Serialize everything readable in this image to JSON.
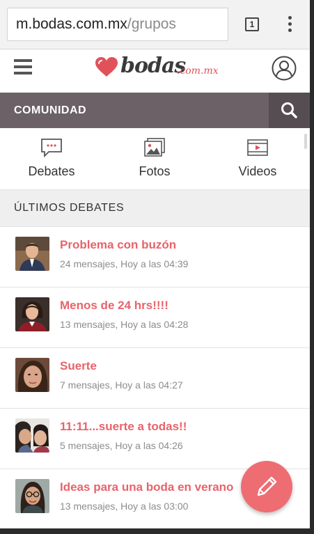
{
  "browser": {
    "url_domain": "m.bodas.com.mx",
    "url_path": "/grupos",
    "tab_count": "1",
    "menu_icon": "overflow-menu-icon"
  },
  "header": {
    "logo_text": "bodas",
    "logo_suffix": ".com.mx",
    "menu_icon": "hamburger-icon",
    "account_icon": "user-avatar-icon",
    "brand_color": "#e0525a"
  },
  "community": {
    "label": "COMUNIDAD",
    "search_icon": "search-icon",
    "bar_color": "#6b6167"
  },
  "tabs": [
    {
      "label": "Debates",
      "icon": "chat-bubble-icon"
    },
    {
      "label": "Fotos",
      "icon": "photo-icon"
    },
    {
      "label": "Videos",
      "icon": "video-icon"
    }
  ],
  "latest": {
    "heading": "ÚLTIMOS DEBATES"
  },
  "debates": [
    {
      "title": "Problema con buzón",
      "meta": "24 mensajes, Hoy a las 04:39"
    },
    {
      "title": "Menos de 24 hrs!!!!",
      "meta": "13 mensajes, Hoy a las 04:28"
    },
    {
      "title": "Suerte",
      "meta": "7 mensajes, Hoy a las 04:27"
    },
    {
      "title": "11:11...suerte a todas!!",
      "meta": "5 mensajes, Hoy a las 04:26"
    },
    {
      "title": "Ideas para una boda en verano",
      "meta": "13 mensajes, Hoy a las 03:00"
    }
  ],
  "fab": {
    "icon": "pencil-icon",
    "color": "#ee6d73"
  }
}
